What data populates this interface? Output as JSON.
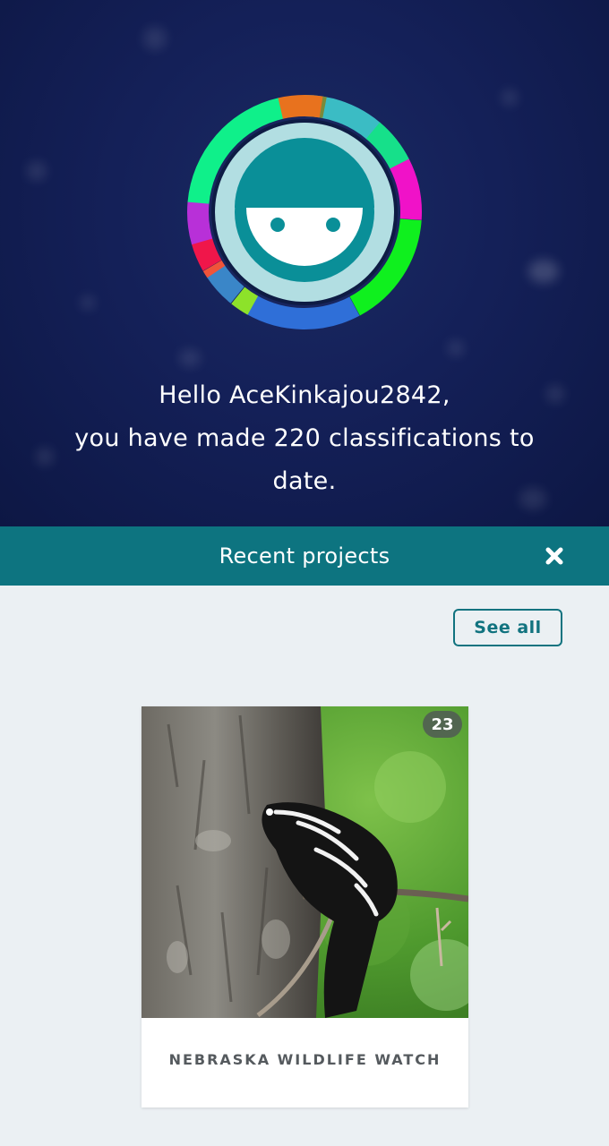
{
  "hero": {
    "line1": "Hello AceKinkajou2842,",
    "line2": "you have made 220 classifications to",
    "line3": "date."
  },
  "recent": {
    "title": "Recent projects",
    "close_icon": "close-icon",
    "see_all_label": "See all"
  },
  "projects": [
    {
      "name": "NEBRASKA WILDLIFE WATCH",
      "count": "23",
      "image": "spotted-skunk-on-tree"
    }
  ],
  "colors": {
    "hero_bg": "#142058",
    "bar_bg": "#0d7480",
    "accent": "#11737f",
    "page_bg": "#ebf0f3",
    "avatar_teal": "#0a8f98",
    "avatar_ring": "#b2dee2"
  }
}
